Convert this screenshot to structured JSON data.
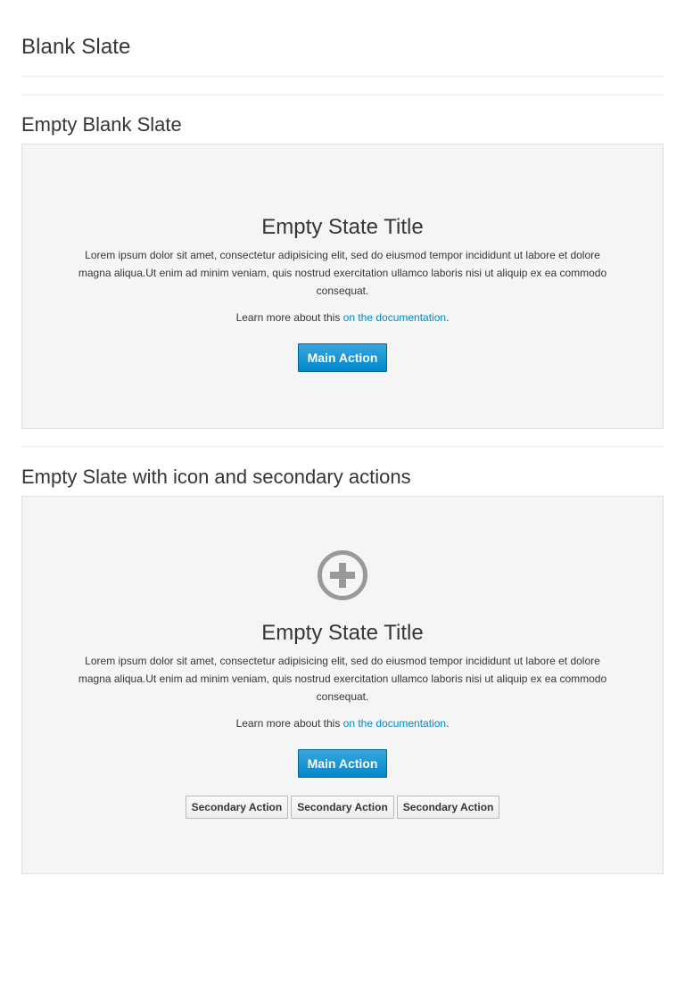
{
  "page": {
    "title": "Blank Slate"
  },
  "sections": [
    {
      "heading": "Empty Blank Slate",
      "title": "Empty State Title",
      "description": "Lorem ipsum dolor sit amet, consectetur adipisicing elit, sed do eiusmod tempor incididunt ut labore et dolore magna aliqua.Ut enim ad minim veniam, quis nostrud exercitation ullamco laboris nisi ut aliquip ex ea commodo consequat.",
      "help_prefix": "Learn more about this ",
      "help_link": "on the documentation",
      "help_suffix": ".",
      "main_action": "Main Action"
    },
    {
      "heading": "Empty Slate with icon and secondary actions",
      "icon": "plus-circle-icon",
      "title": "Empty State Title",
      "description": "Lorem ipsum dolor sit amet, consectetur adipisicing elit, sed do eiusmod tempor incididunt ut labore et dolore magna aliqua.Ut enim ad minim veniam, quis nostrud exercitation ullamco laboris nisi ut aliquip ex ea commodo consequat.",
      "help_prefix": "Learn more about this ",
      "help_link": "on the documentation",
      "help_suffix": ".",
      "main_action": "Main Action",
      "secondary_actions": [
        "Secondary Action",
        "Secondary Action",
        "Secondary Action"
      ]
    }
  ],
  "colors": {
    "link": "#0088ce",
    "primary_button": "#0088ce",
    "slate_background": "#f5f5f5",
    "icon": "#999999"
  }
}
